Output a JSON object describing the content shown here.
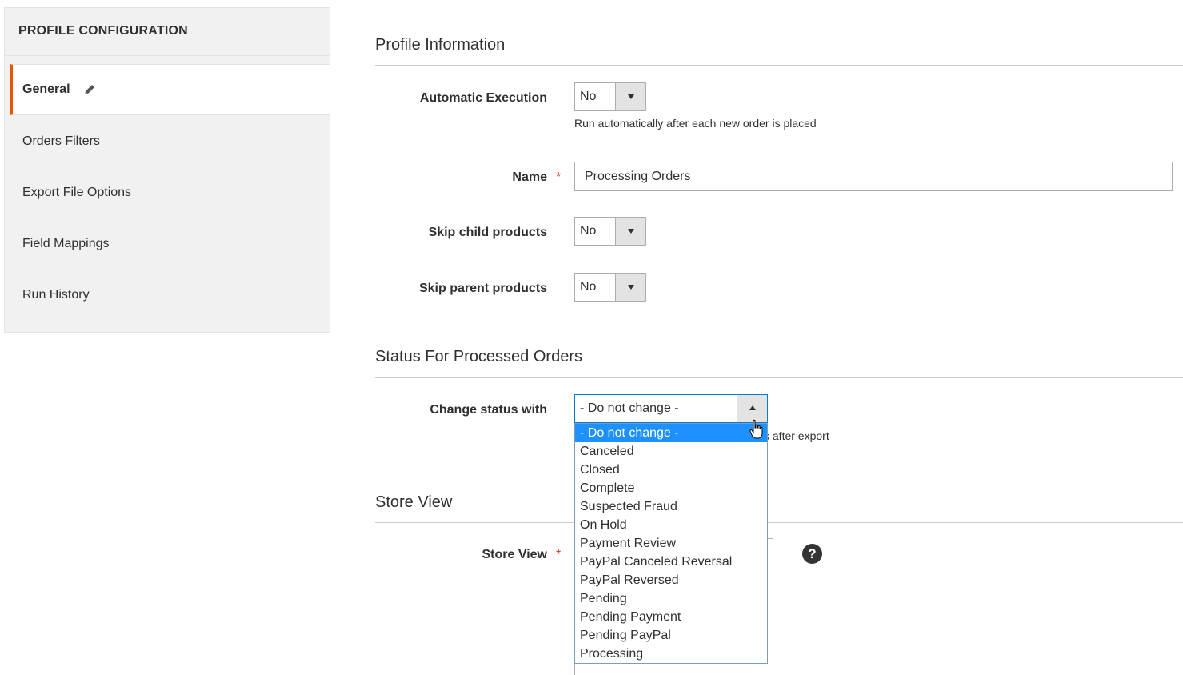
{
  "sidebar": {
    "title": "PROFILE CONFIGURATION",
    "items": [
      {
        "label": "General",
        "active": true
      },
      {
        "label": "Orders Filters"
      },
      {
        "label": "Export File Options"
      },
      {
        "label": "Field Mappings"
      },
      {
        "label": "Run History"
      }
    ]
  },
  "sections": {
    "profile": {
      "title": "Profile Information",
      "automatic_execution": {
        "label": "Automatic Execution",
        "value": "No",
        "note": "Run automatically after each new order is placed"
      },
      "name": {
        "label": "Name",
        "required_mark": "*",
        "value": "Processing Orders"
      },
      "skip_child": {
        "label": "Skip child products",
        "value": "No"
      },
      "skip_parent": {
        "label": "Skip parent products",
        "value": "No"
      }
    },
    "status": {
      "title": "Status For Processed Orders",
      "change_status": {
        "label": "Change status with",
        "value": "- Do not change -",
        "note_visible": "s after export",
        "options": [
          "- Do not change -",
          "Canceled",
          "Closed",
          "Complete",
          "Suspected Fraud",
          "On Hold",
          "Payment Review",
          "PayPal Canceled Reversal",
          "PayPal Reversed",
          "Pending",
          "Pending Payment",
          "Pending PayPal",
          "Processing"
        ]
      }
    },
    "store": {
      "title": "Store View",
      "store_view": {
        "label": "Store View",
        "required_mark": "*",
        "help": "?"
      }
    }
  },
  "colors": {
    "accent": "#eb5202",
    "required": "#e22626",
    "selection": "#1e90ff",
    "focus": "#007bdb"
  }
}
